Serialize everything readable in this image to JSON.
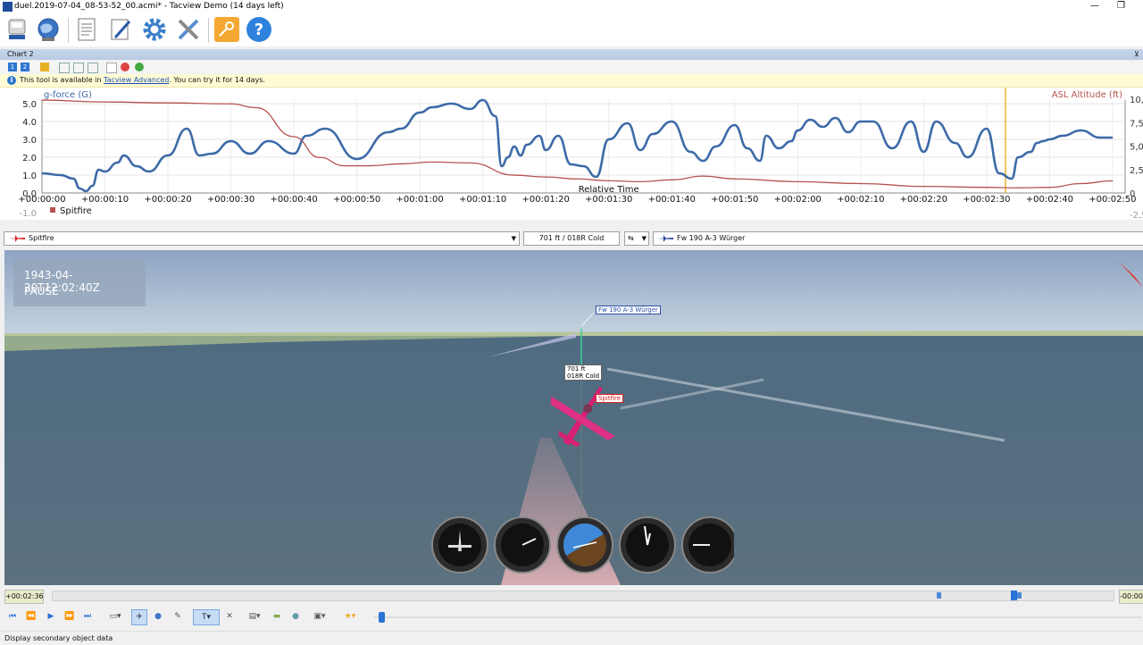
{
  "window": {
    "title": "duel.2019-07-04_08-53-52_00.acmi* - Tacview Demo (14 days left)",
    "minimize": "—",
    "restore": "❐"
  },
  "toolbar": {
    "buttons": [
      "open-recording",
      "online-globe",
      "document",
      "edit",
      "settings",
      "tools",
      "license-key",
      "help"
    ]
  },
  "chart_panel": {
    "tab_title": "Chart 2",
    "tab_pin": "⊻",
    "info_prefix": "This tool is available in ",
    "info_link": "Tacview Advanced",
    "info_suffix": ". You can try it for 14 days.",
    "tool_buttons": [
      "1",
      "2"
    ]
  },
  "chart_data": {
    "type": "line",
    "xlabel": "Relative Time",
    "x_ticks": [
      "+00:00:00",
      "+00:00:10",
      "+00:00:20",
      "+00:00:30",
      "+00:00:40",
      "+00:00:50",
      "+00:01:00",
      "+00:01:10",
      "+00:01:20",
      "+00:01:30",
      "+00:01:40",
      "+00:01:50",
      "+00:02:00",
      "+00:02:10",
      "+00:02:20",
      "+00:02:30",
      "+00:02:40",
      "+00:02:50"
    ],
    "y_left_label": "g-force (G)",
    "y_left_ticks": [
      "5.0",
      "4.0",
      "3.0",
      "2.0",
      "1.0",
      "0.0",
      "-1.0"
    ],
    "y_right_label": "ASL Altitude (ft)",
    "y_right_ticks": [
      "10,000",
      "7,500",
      "5,000",
      "2,500",
      "0",
      "-2,500"
    ],
    "legend": "Spitfire",
    "cursor_time_s": 153,
    "series": [
      {
        "name": "g-force",
        "axis": "left",
        "color": "#3d6aa8",
        "x": [
          0,
          3,
          5,
          6,
          7,
          8,
          9,
          10,
          12,
          13,
          15,
          17,
          20,
          23,
          25,
          27,
          30,
          33,
          36,
          40,
          42,
          45,
          50,
          55,
          57,
          60,
          62,
          65,
          68,
          70,
          72,
          73,
          74,
          75,
          76,
          77,
          79,
          80,
          82,
          84,
          86,
          88,
          90,
          93,
          95,
          97,
          100,
          103,
          105,
          107,
          110,
          112,
          114,
          115,
          117,
          119,
          120,
          122,
          124,
          126,
          128,
          130,
          132,
          135,
          138,
          140,
          142,
          145,
          147,
          150,
          152,
          154,
          155,
          157,
          158,
          159,
          160,
          162,
          165,
          168,
          170
        ],
        "values": [
          1.1,
          1.0,
          0.8,
          0.25,
          0.1,
          0.4,
          1.3,
          1.2,
          1.7,
          2.1,
          1.5,
          1.2,
          2.1,
          3.6,
          2.1,
          2.2,
          2.9,
          2.2,
          2.9,
          2.2,
          3.2,
          3.6,
          1.9,
          3.4,
          3.6,
          4.5,
          4.8,
          5.0,
          4.7,
          5.2,
          4.3,
          1.5,
          2.0,
          2.6,
          2.1,
          2.7,
          3.2,
          2.4,
          3.2,
          1.6,
          1.5,
          0.9,
          3.0,
          3.9,
          2.4,
          3.3,
          4.0,
          2.3,
          1.8,
          2.6,
          3.8,
          2.5,
          1.8,
          3.2,
          2.5,
          2.9,
          3.5,
          4.1,
          3.7,
          4.2,
          3.4,
          4.0,
          4.0,
          2.5,
          4.0,
          2.3,
          4.0,
          2.8,
          2.0,
          3.6,
          1.1,
          0.8,
          2.0,
          2.3,
          2.8,
          2.9,
          3.0,
          3.2,
          3.5,
          3.1,
          3.1
        ]
      },
      {
        "name": "ASL Altitude",
        "axis": "right",
        "color": "#b5524f",
        "x": [
          0,
          10,
          20,
          30,
          34,
          40,
          44,
          48,
          52,
          57,
          62,
          68,
          75,
          80,
          85,
          90,
          95,
          100,
          105,
          110,
          120,
          130,
          140,
          150,
          155,
          160,
          165,
          170
        ],
        "values": [
          9900,
          9700,
          9600,
          9500,
          9100,
          6000,
          3800,
          2900,
          2900,
          3100,
          3300,
          3200,
          1900,
          1700,
          1500,
          1300,
          1200,
          1400,
          1800,
          1500,
          1200,
          1000,
          700,
          600,
          550,
          600,
          1000,
          1300
        ]
      }
    ]
  },
  "selectors": {
    "primary": "Spitfire",
    "readout": "701 ft / 018R Cold",
    "secondary": "Fw 190 A-3 Würger"
  },
  "view": {
    "timestamp": "1943-04-20T12:02:40Z",
    "state": "PAUSE",
    "target_label": "Fw 190 A-3 Würger",
    "readout_line1": "701 ft",
    "readout_line2": "018R Cold",
    "aircraft_label": "Spitfire",
    "instruments": [
      "airspeed-indicator",
      "altimeter",
      "attitude-indicator",
      "clock",
      "vertical-speed-indicator"
    ]
  },
  "timeline": {
    "current": "+00:02:36",
    "remaining": "-00:00:"
  },
  "status": {
    "message": "Display secondary object data"
  }
}
